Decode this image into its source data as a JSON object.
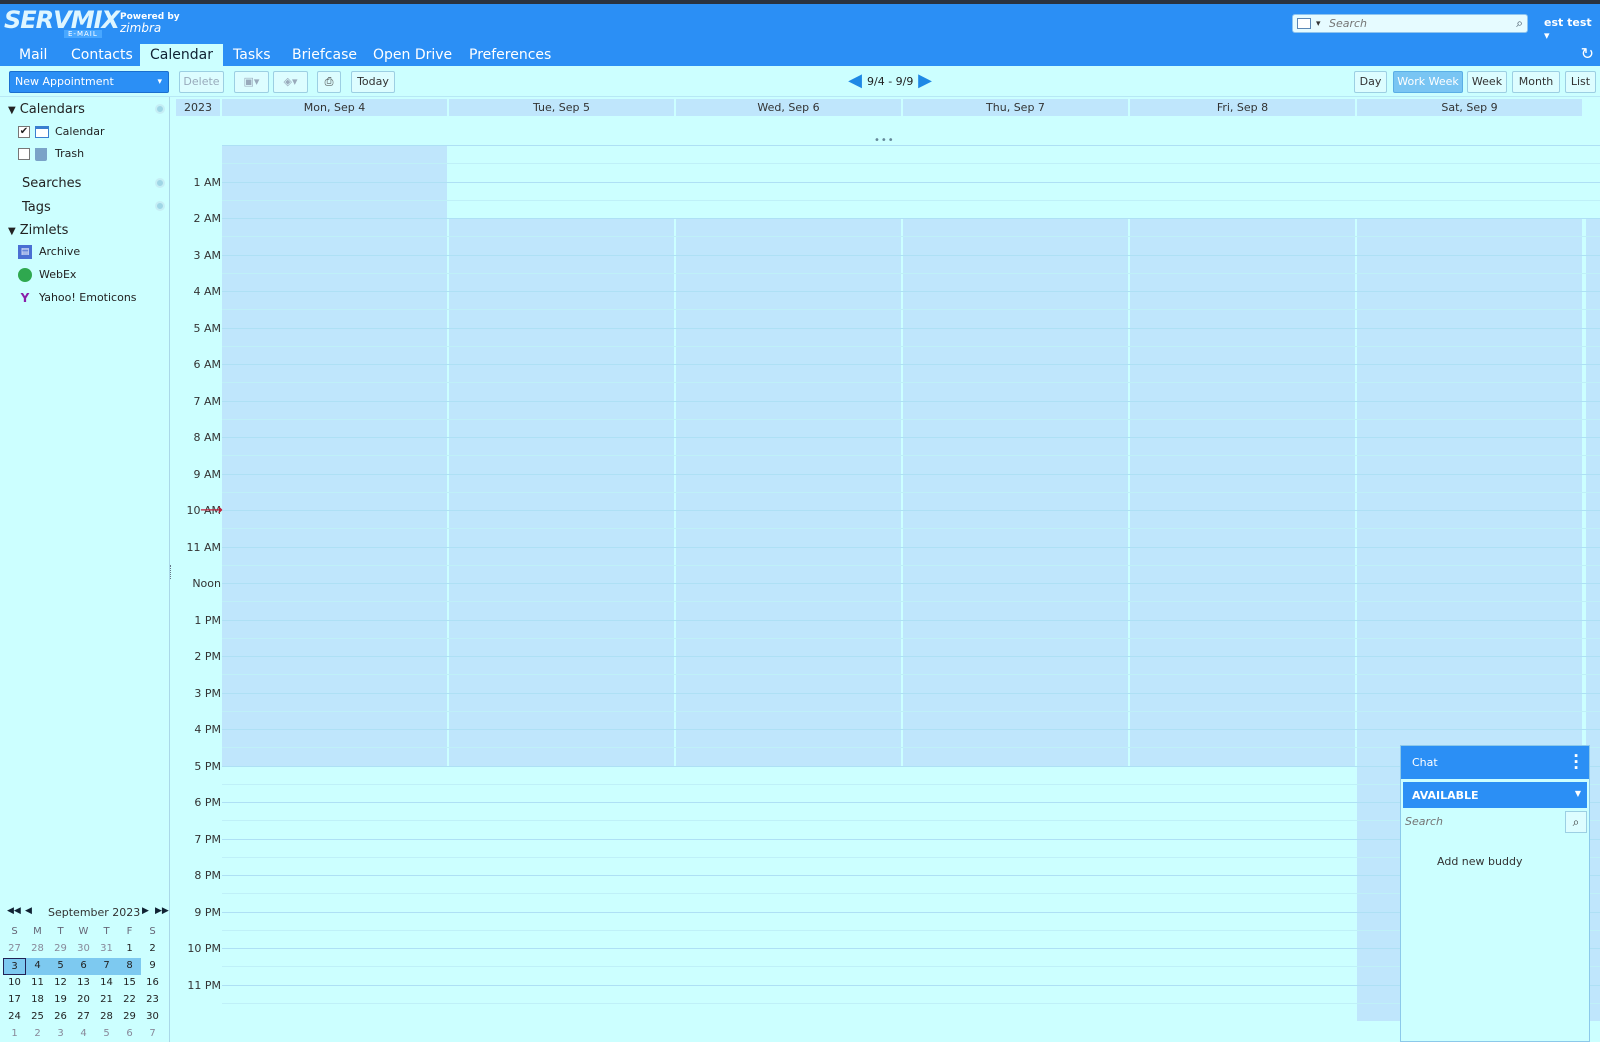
{
  "header": {
    "logo_text": "SERVMIX",
    "logo_sub": "E-MAIL",
    "powered_by": "Powered by",
    "powered_brand": "zimbra",
    "search_placeholder": "Search",
    "user": "est test ▾"
  },
  "tabs": [
    {
      "label": "Mail"
    },
    {
      "label": "Contacts"
    },
    {
      "label": "Calendar",
      "active": true
    },
    {
      "label": "Tasks"
    },
    {
      "label": "Briefcase"
    },
    {
      "label": "Open Drive"
    },
    {
      "label": "Preferences"
    }
  ],
  "toolbar": {
    "new_appointment": "New Appointment",
    "delete": "Delete",
    "today": "Today",
    "date_range": "9/4 - 9/9",
    "views": [
      "Day",
      "Work Week",
      "Week",
      "Month",
      "List"
    ],
    "active_view": "Work Week"
  },
  "sidebar": {
    "calendars_title": "Calendars",
    "calendars": [
      {
        "label": "Calendar",
        "checked": true,
        "icon": "calendar-icon"
      },
      {
        "label": "Trash",
        "checked": false,
        "icon": "trash-icon"
      }
    ],
    "searches_title": "Searches",
    "tags_title": "Tags",
    "zimlets_title": "Zimlets",
    "zimlets": [
      {
        "label": "Archive",
        "icon": "archive-icon"
      },
      {
        "label": "WebEx",
        "icon": "webex-globe-icon"
      },
      {
        "label": "Yahoo! Emoticons",
        "icon": "yahoo-y-icon"
      }
    ]
  },
  "minical": {
    "title": "September 2023",
    "weekday_headers": [
      "S",
      "M",
      "T",
      "W",
      "T",
      "F",
      "S"
    ],
    "weeks": [
      [
        "27",
        "28",
        "29",
        "30",
        "31",
        "1",
        "2"
      ],
      [
        "3",
        "4",
        "5",
        "6",
        "7",
        "8",
        "9"
      ],
      [
        "10",
        "11",
        "12",
        "13",
        "14",
        "15",
        "16"
      ],
      [
        "17",
        "18",
        "19",
        "20",
        "21",
        "22",
        "23"
      ],
      [
        "24",
        "25",
        "26",
        "27",
        "28",
        "29",
        "30"
      ],
      [
        "1",
        "2",
        "3",
        "4",
        "5",
        "6",
        "7"
      ]
    ]
  },
  "calendar": {
    "year": "2023",
    "days": [
      "Mon, Sep 4",
      "Tue, Sep 5",
      "Wed, Sep 6",
      "Thu, Sep 7",
      "Fri, Sep 8",
      "Sat, Sep 9"
    ],
    "hours": [
      "1 AM",
      "2 AM",
      "3 AM",
      "4 AM",
      "5 AM",
      "6 AM",
      "7 AM",
      "8 AM",
      "9 AM",
      "10 AM",
      "11 AM",
      "Noon",
      "1 PM",
      "2 PM",
      "3 PM",
      "4 PM",
      "5 PM",
      "6 PM",
      "7 PM",
      "8 PM",
      "9 PM",
      "10 PM",
      "11 PM"
    ],
    "colors": {
      "working_hours": "#bfe6fc",
      "off_hours": "#ccffff",
      "accent": "#2b8ff5"
    }
  },
  "chat": {
    "title": "Chat",
    "status": "AVAILABLE",
    "search_placeholder": "Search",
    "add_buddy": "Add new buddy"
  }
}
